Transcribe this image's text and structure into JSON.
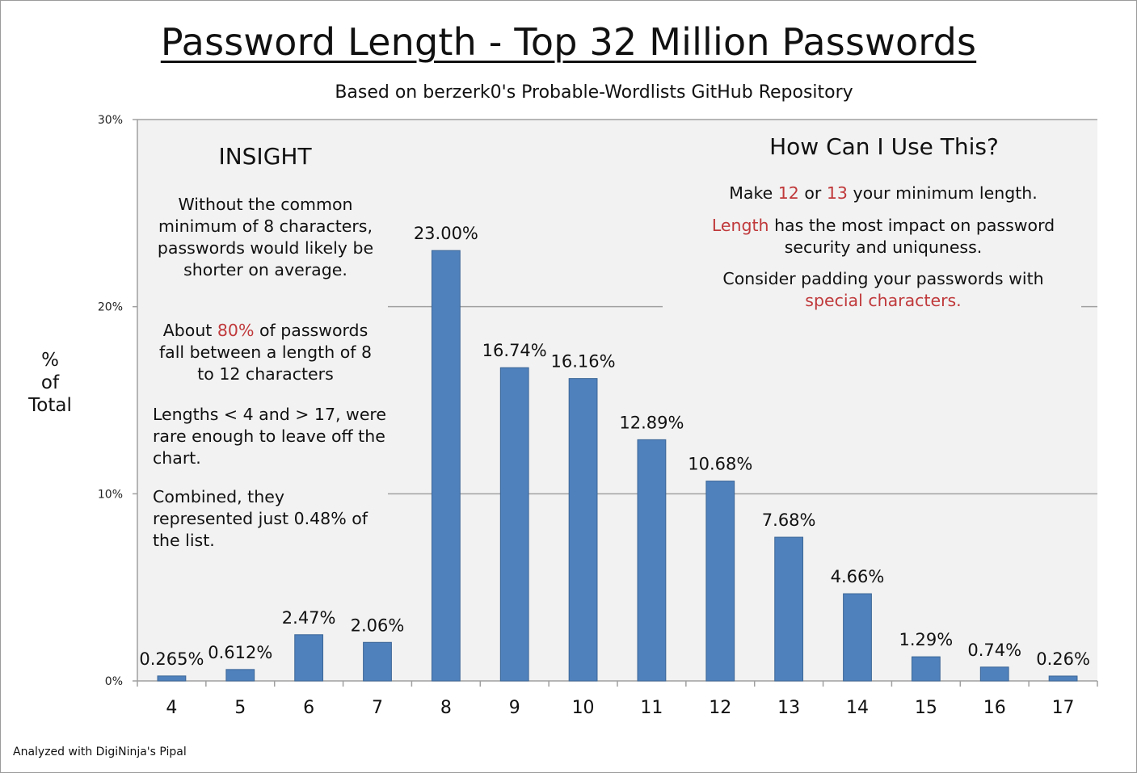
{
  "title": "Password Length - Top 32 Million Passwords",
  "subtitle": "Based on berzerk0's Probable-Wordlists GitHub Repository",
  "footer": "Analyzed with DigiNinja's Pipal",
  "colors": {
    "bar_fill": "#4f81bd",
    "bar_stroke": "#3b6696",
    "accent": "#c0393b",
    "plot_background": "#f2f2f2",
    "grid": "#a0a0a0"
  },
  "insight": {
    "heading": "INSIGHT",
    "p1": "Without the  common minimum of 8 characters, passwords would likely be shorter on average.",
    "p2_pre": "About ",
    "p2_accent": "80%",
    "p2_post": " of passwords fall between a length of 8 to 12 characters",
    "p3": "Lengths < 4 and  > 17, were rare enough to leave off the chart.",
    "p4": "Combined, they represented just 0.48% of the list."
  },
  "how": {
    "heading": "How Can I Use This?",
    "p1_pre": "Make ",
    "p1_accent1": "12",
    "p1_mid": " or ",
    "p1_accent2": "13",
    "p1_post": " your minimum length.",
    "p2_accent": "Length",
    "p2_post": " has the most impact on password security and uniquness.",
    "p3_pre": "Consider padding your passwords with ",
    "p3_accent": "special characters."
  },
  "chart_data": {
    "type": "bar",
    "title": "Password Length - Top 32 Million Passwords",
    "subtitle": "Based on berzerk0's Probable-Wordlists GitHub Repository",
    "xlabel": "",
    "ylabel": "% of Total",
    "ylabel_lines": [
      "%",
      "of",
      "Total"
    ],
    "ylim": [
      0,
      30
    ],
    "yticks": [
      0,
      10,
      20,
      30
    ],
    "ytick_labels": [
      "0%",
      "10%",
      "20%",
      "30%"
    ],
    "grid": true,
    "categories": [
      "4",
      "5",
      "6",
      "7",
      "8",
      "9",
      "10",
      "11",
      "12",
      "13",
      "14",
      "15",
      "16",
      "17"
    ],
    "values": [
      0.265,
      0.612,
      2.47,
      2.06,
      23.0,
      16.74,
      16.16,
      12.89,
      10.68,
      7.68,
      4.66,
      1.29,
      0.74,
      0.26
    ],
    "data_labels": [
      "0.265%",
      "0.612%",
      "2.47%",
      "2.06%",
      "23.00%",
      "16.74%",
      "16.16%",
      "12.89%",
      "10.68%",
      "7.68%",
      "4.66%",
      "1.29%",
      "0.74%",
      "0.26%"
    ],
    "legend": "none"
  }
}
